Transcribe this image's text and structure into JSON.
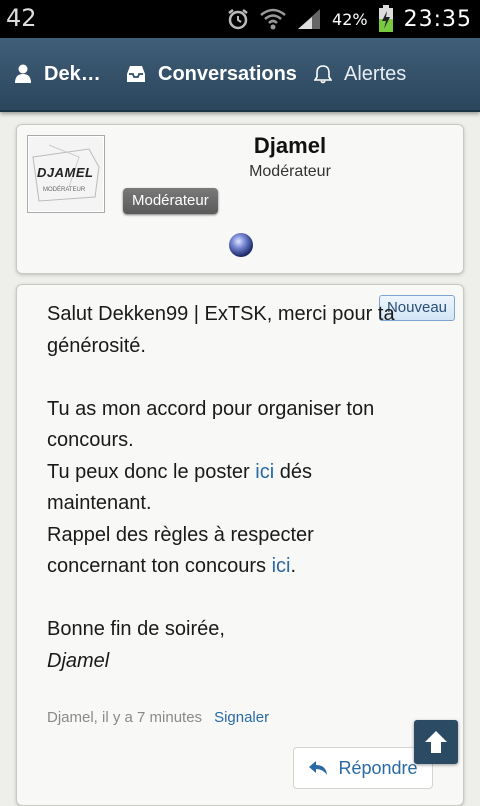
{
  "statusbar": {
    "left_text": "42",
    "battery_percent": "42%",
    "time": "23:35",
    "icons": [
      "alarm-icon",
      "wifi-icon",
      "signal-icon",
      "battery-charging-icon"
    ]
  },
  "nav": {
    "items": [
      {
        "label": "Dek…",
        "icon": "user-icon"
      },
      {
        "label": "Conversations",
        "icon": "inbox-icon"
      },
      {
        "label": "Alertes",
        "icon": "bell-icon"
      }
    ]
  },
  "profile": {
    "avatar_text": "DJAMEL",
    "avatar_subtext": "MODÉRATEUR",
    "username": "Djamel",
    "title": "Modérateur",
    "role_badge": "Modérateur"
  },
  "message": {
    "badge": "Nouveau",
    "p1": "Salut Dekken99 | ExTSK, merci pour ta générosité.",
    "p2": "Tu as mon accord pour organiser ton concours.",
    "p3_before": "Tu peux donc le poster ",
    "p3_link": "ici",
    "p3_after": " dés maintenant.",
    "p4_before": "Rappel des règles à respecter concernant ton concours ",
    "p4_link": "ici",
    "p4_after": ".",
    "p5": "Bonne fin de soirée,",
    "signature": "Djamel",
    "meta": "Djamel, il y a 7 minutes",
    "report_link": "Signaler",
    "reply_label": "Répondre"
  },
  "colors": {
    "navbar": "#2b465d",
    "link": "#2a6aa4",
    "badge_grey": "#5a5a5a"
  }
}
